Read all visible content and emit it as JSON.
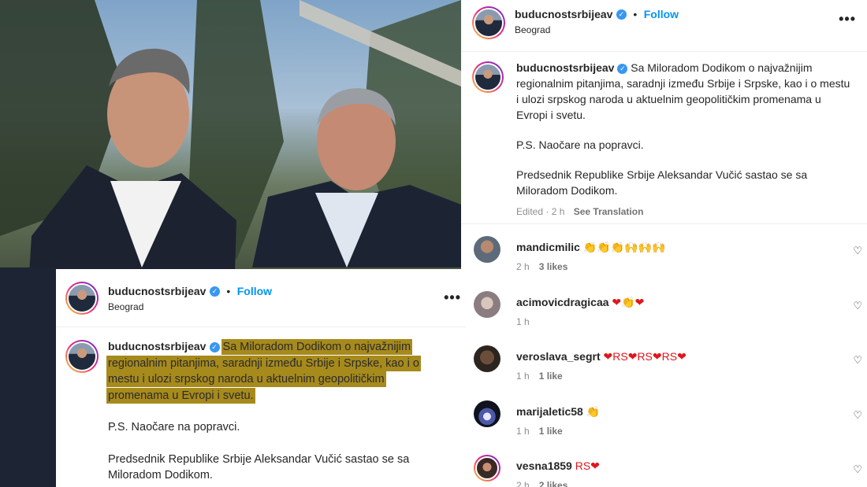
{
  "post": {
    "username": "buducnostsrbijeav",
    "follow_label": "Follow",
    "separator": "•",
    "location": "Beograd",
    "more_label": "•••",
    "caption": {
      "lead": "Sa Miloradom Dodikom o najvažnijim regionalnim pitanjima, saradnji između Srbije i Srpske, kao i o mestu i ulozi srpskog naroda u aktuelnim geopolitičkim promenama u Evropi i svetu.",
      "ps": "P.S. Naočare na popravci.",
      "summary": "Predsednik Republike Srbije Aleksandar Vučić sastao se sa Miloradom Dodikom."
    },
    "meta": {
      "edited": "Edited · 2 h",
      "see_translation": "See Translation"
    }
  },
  "comments": [
    {
      "user": "mandicmilic",
      "emoji": "👏👏👏🙌🙌🙌",
      "time": "2 h",
      "likes": "3 likes"
    },
    {
      "user": "acimovicdragicaa",
      "emoji": "❤👏❤",
      "time": "1 h",
      "likes": ""
    },
    {
      "user": "veroslava_segrt",
      "emoji": "❤RS❤RS❤RS❤",
      "time": "1 h",
      "likes": "1 like"
    },
    {
      "user": "marijaletic58",
      "emoji": "👏",
      "time": "1 h",
      "likes": "1 like"
    },
    {
      "user": "vesna1859",
      "emoji": "RS❤",
      "time": "2 h",
      "likes": "2 likes"
    }
  ],
  "overlay": {
    "username": "buducnostsrbijeav",
    "follow_label": "Follow",
    "location": "Beograd",
    "caption_lines": [
      "Sa Miloradom Dodikom o najvažnijim",
      "regionalnim pitanjima, saradnji između Srbije i Srpske, kao i o",
      "mestu i ulozi srpskog naroda u aktuelnim geopolitičkim",
      "promenama u Evropi i svetu."
    ],
    "ps": "P.S. Naočare na popravci.",
    "summary": "Predsednik Republike Srbije Aleksandar Vučić sastao se sa Miloradom Dodikom."
  },
  "icons": {
    "verified": "verified-badge-icon",
    "heart": "heart-icon",
    "more": "more-options-icon"
  },
  "colors": {
    "follow": "#0095f6",
    "highlight": "#a68a1c",
    "verified": "#3897f0"
  }
}
